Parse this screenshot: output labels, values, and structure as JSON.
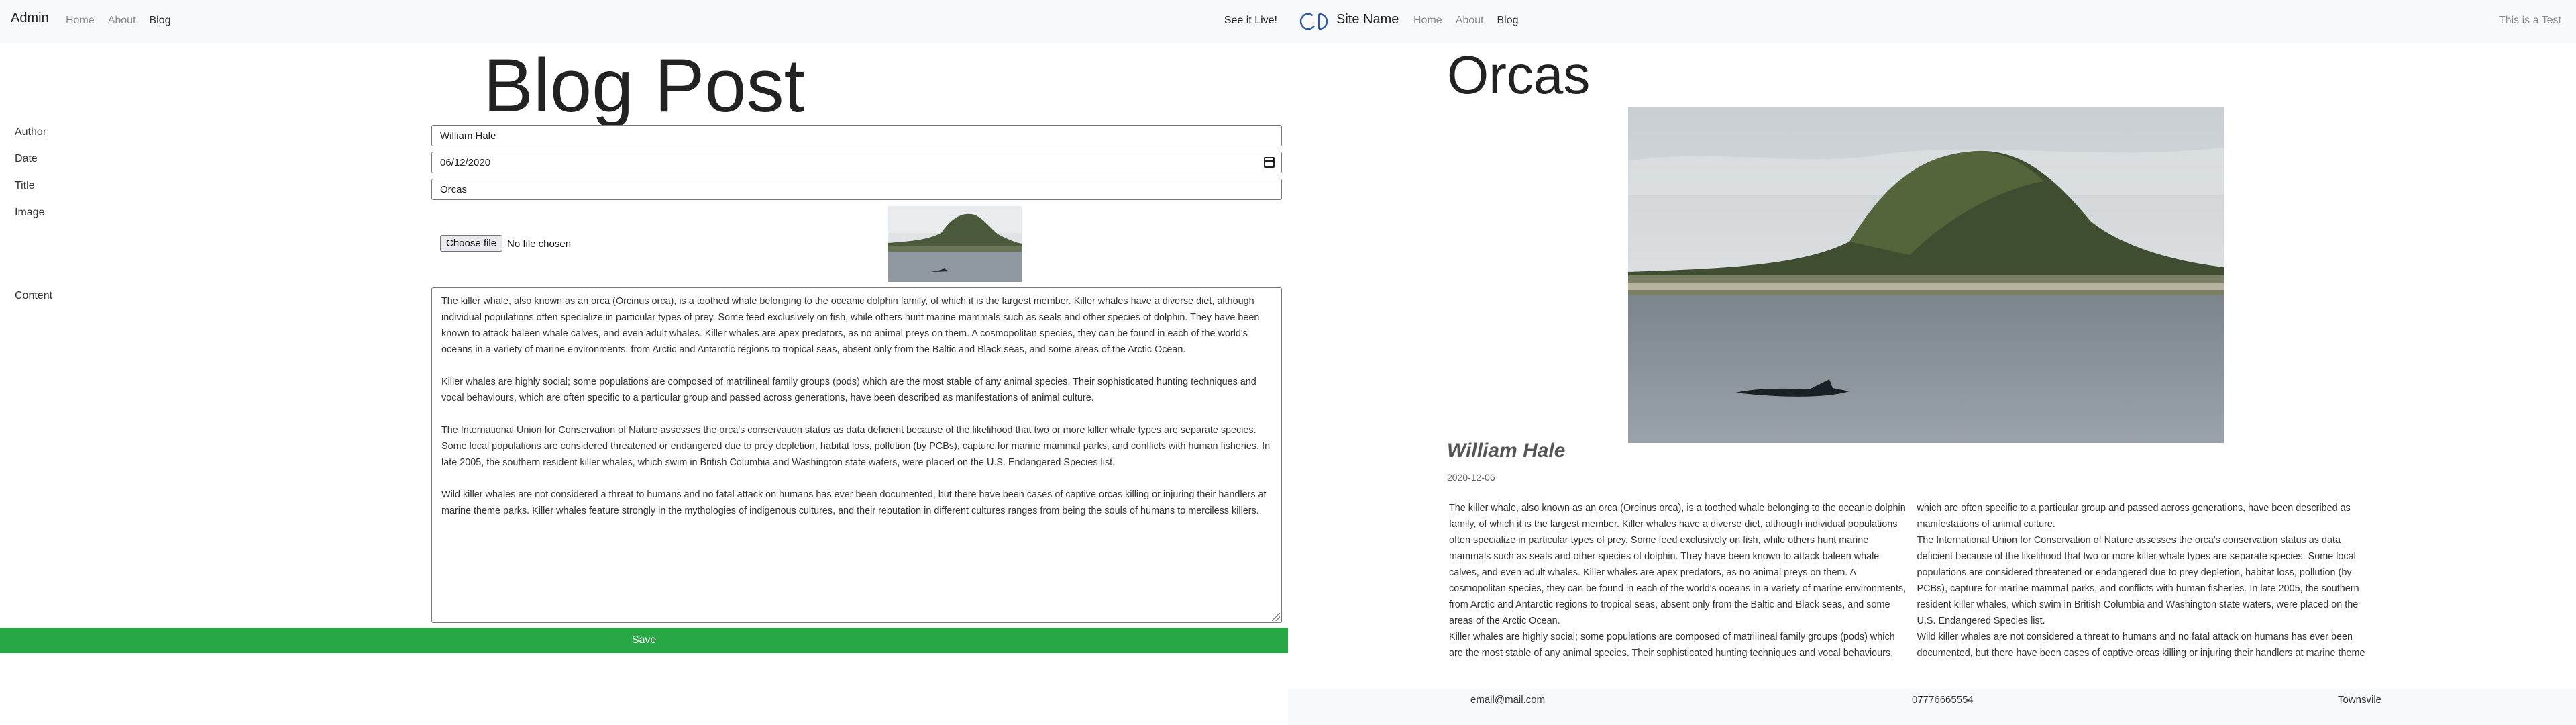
{
  "admin": {
    "brand": "Admin",
    "nav": {
      "home": "Home",
      "about": "About",
      "blog": "Blog"
    },
    "see_live": "See it Live!",
    "heading": "Blog Post",
    "form": {
      "author_label": "Author",
      "author_value": "William Hale",
      "date_label": "Date",
      "date_value": "06/12/2020",
      "title_label": "Title",
      "title_value": "Orcas",
      "image_label": "Image",
      "choose_file": "Choose file",
      "no_file": "No file chosen",
      "content_label": "Content",
      "content_paragraphs": [
        "The killer whale, also known as an orca (Orcinus orca), is a toothed whale belonging to the oceanic dolphin family, of which it is the largest member. Killer whales have a diverse diet, although individual populations often specialize in particular types of prey. Some feed exclusively on fish, while others hunt marine mammals such as seals and other species of dolphin. They have been known to attack baleen whale calves, and even adult whales. Killer whales are apex predators, as no animal preys on them. A cosmopolitan species, they can be found in each of the world's oceans in a variety of marine environments, from Arctic and Antarctic regions to tropical seas, absent only from the Baltic and Black seas, and some areas of the Arctic Ocean.",
        "Killer whales are highly social; some populations are composed of matrilineal family groups (pods) which are the most stable of any animal species. Their sophisticated hunting techniques and vocal behaviours, which are often specific to a particular group and passed across generations, have been described as manifestations of animal culture.",
        "The International Union for Conservation of Nature assesses the orca's conservation status as data deficient because of the likelihood that two or more killer whale types are separate species. Some local populations are considered threatened or endangered due to prey depletion, habitat loss, pollution (by PCBs), capture for marine mammal parks, and conflicts with human fisheries. In late 2005, the southern resident killer whales, which swim in British Columbia and Washington state waters, were placed on the U.S. Endangered Species list.",
        "Wild killer whales are not considered a threat to humans and no fatal attack on humans has ever been documented, but there have been cases of captive orcas killing or injuring their handlers at marine theme parks. Killer whales feature strongly in the mythologies of indigenous cultures, and their reputation in different cultures ranges from being the souls of humans to merciless killers."
      ]
    },
    "save_label": "Save"
  },
  "site": {
    "logo_text": "CD",
    "name": "Site Name",
    "nav": {
      "home": "Home",
      "about": "About",
      "blog": "Blog"
    },
    "tagline": "This is a Test",
    "post": {
      "title": "Orcas",
      "author": "William Hale",
      "date": "2020-12-06"
    },
    "footer": {
      "email": "email@mail.com",
      "phone": "07776665554",
      "town": "Townsvile"
    }
  }
}
